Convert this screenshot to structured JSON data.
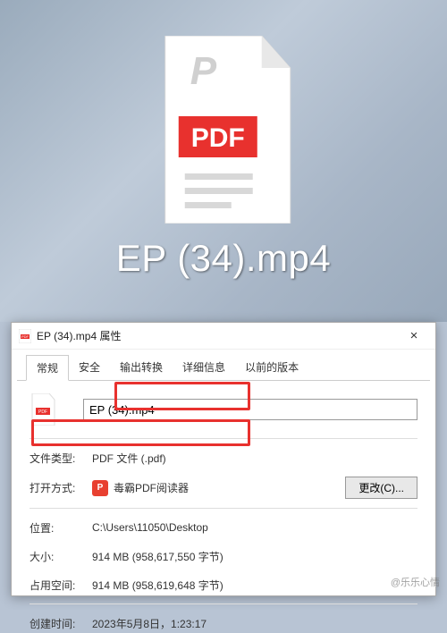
{
  "desktop": {
    "file_label": "EP (34).mp4"
  },
  "dialog": {
    "title": "EP (34).mp4 属性",
    "close": "×",
    "tabs": [
      "常规",
      "安全",
      "输出转换",
      "详细信息",
      "以前的版本"
    ],
    "filename": "EP (34).mp4",
    "labels": {
      "filetype": "文件类型:",
      "opens_with": "打开方式:",
      "location": "位置:",
      "size": "大小:",
      "size_on_disk": "占用空间:",
      "created": "创建时间:"
    },
    "values": {
      "filetype": "PDF 文件 (.pdf)",
      "opens_with": "毒霸PDF阅读器",
      "location": "C:\\Users\\11050\\Desktop",
      "size": "914 MB (958,617,550 字节)",
      "size_on_disk": "914 MB (958,619,648 字节)",
      "created": "2023年5月8日，1:23:17"
    },
    "change_btn": "更改(C)..."
  },
  "watermark": "@乐乐心情"
}
